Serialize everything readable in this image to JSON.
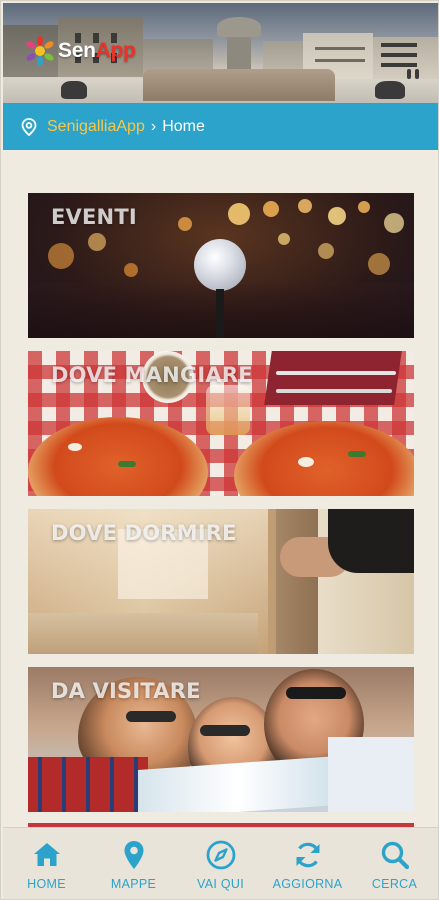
{
  "header": {
    "logo_text_primary": "Sen",
    "logo_text_accent": "App"
  },
  "breadcrumb": {
    "icon": "map-pin-icon",
    "app": "SenigalliaApp",
    "separator": "›",
    "current": "Home"
  },
  "cards": [
    {
      "id": "eventi",
      "title": "EVENTI"
    },
    {
      "id": "mangiare",
      "title": "DOVE MANGIARE"
    },
    {
      "id": "dormire",
      "title": "DOVE DORMIRE"
    },
    {
      "id": "visitare",
      "title": "DA VISITARE"
    }
  ],
  "bottom_nav": [
    {
      "label": "HOME",
      "icon": "home-icon"
    },
    {
      "label": "MAPPE",
      "icon": "map-marker-icon"
    },
    {
      "label": "VAI QUI",
      "icon": "compass-icon"
    },
    {
      "label": "AGGIORNA",
      "icon": "refresh-icon"
    },
    {
      "label": "CERCA",
      "icon": "search-icon"
    }
  ],
  "colors": {
    "accent_blue": "#2ba3cb",
    "breadcrumb_yellow": "#f5c84a",
    "background": "#efebe1",
    "brand_red": "#e8332a"
  }
}
